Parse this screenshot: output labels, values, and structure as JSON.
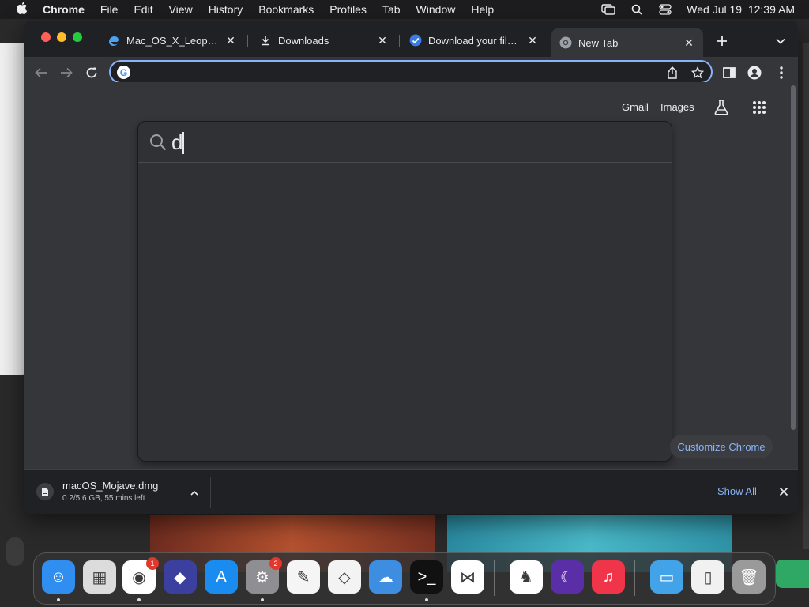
{
  "menubar": {
    "app_name": "Chrome",
    "items": [
      "File",
      "Edit",
      "View",
      "History",
      "Bookmarks",
      "Profiles",
      "Tab",
      "Window",
      "Help"
    ],
    "clock": "Wed Jul 19  12:39 AM"
  },
  "tabs": [
    {
      "title": "Mac_OS_X_Leopard_",
      "favicon": "edge-icon"
    },
    {
      "title": "Downloads",
      "favicon": "download-icon"
    },
    {
      "title": "Download your file now",
      "favicon": "check-icon"
    },
    {
      "title": "New Tab",
      "favicon": "chrome-icon",
      "active": true
    }
  ],
  "omnibox": {
    "value": "",
    "g_letter": "G"
  },
  "ntp": {
    "gmail": "Gmail",
    "images": "Images",
    "customize": "Customize Chrome"
  },
  "search_dropdown": {
    "query": "d"
  },
  "download_bar": {
    "file_name": "macOS_Mojave.dmg",
    "status": "0.2/5.6 GB, 55 mins left",
    "show_all": "Show All"
  },
  "dock": {
    "apps": [
      {
        "name": "finder-icon",
        "color": "#2f8ef0",
        "glyph": "☺"
      },
      {
        "name": "launchpad-icon",
        "color": "#dcdcdc",
        "glyph": "▦"
      },
      {
        "name": "chrome-icon",
        "color": "#ffffff",
        "glyph": "◉",
        "badge": "1"
      },
      {
        "name": "shortcuts-icon",
        "color": "#3b3f9e",
        "glyph": "◆"
      },
      {
        "name": "app-store-icon",
        "color": "#1a8cf0",
        "glyph": "A"
      },
      {
        "name": "system-settings-icon",
        "color": "#8e8e93",
        "glyph": "⚙",
        "badge": "2"
      },
      {
        "name": "textedit-icon",
        "color": "#f5f5f5",
        "glyph": "✎"
      },
      {
        "name": "visual-studio-icon",
        "color": "#f3f3f3",
        "glyph": "◇"
      },
      {
        "name": "weather-icon",
        "color": "#3d8ee0",
        "glyph": "☁"
      },
      {
        "name": "terminal-icon",
        "color": "#111111",
        "glyph": ">_"
      },
      {
        "name": "vscode-icon",
        "color": "#ffffff",
        "glyph": "⋈"
      },
      {
        "name": "brave-icon",
        "color": "#ffffff",
        "glyph": "♞"
      },
      {
        "name": "nightshade-icon",
        "color": "#5a2ea6",
        "glyph": "☾"
      },
      {
        "name": "music-icon",
        "color": "#f0354a",
        "glyph": "♫"
      },
      {
        "name": "folder-icon",
        "color": "#43a3e8",
        "glyph": "▭"
      },
      {
        "name": "document-icon",
        "color": "#f1f1f1",
        "glyph": "▯"
      },
      {
        "name": "trash-icon",
        "color": "#9a9a9a",
        "glyph": "🗑"
      }
    ]
  },
  "colors": {
    "accent": "#8ab4f8",
    "ntp_bg": "#35363a",
    "dropdown_bg": "#303134"
  }
}
